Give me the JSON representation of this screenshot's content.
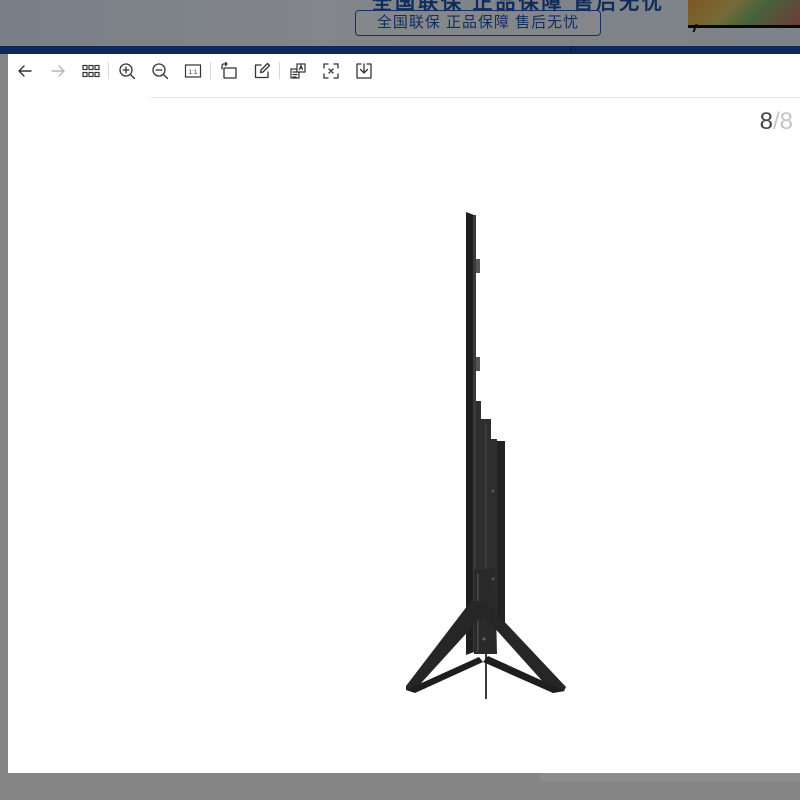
{
  "background": {
    "banner_top_text": "全国联保 正品保障 售后无忧",
    "guarantee_badge": "全国联保   正品保障   售后无忧"
  },
  "viewer": {
    "toolbar": {
      "items": [
        {
          "name": "prev",
          "label": "Previous",
          "icon": "arrow-left-icon"
        },
        {
          "name": "next",
          "label": "Next",
          "icon": "arrow-right-icon"
        },
        {
          "name": "thumbnails",
          "label": "Thumbnails",
          "icon": "grid-icon"
        },
        {
          "name": "zoom-in",
          "label": "Zoom in",
          "icon": "zoom-in-icon"
        },
        {
          "name": "zoom-out",
          "label": "Zoom out",
          "icon": "zoom-out-icon"
        },
        {
          "name": "actual-size",
          "label": "1:1",
          "icon": "actual-size-icon"
        },
        {
          "name": "rotate",
          "label": "Rotate",
          "icon": "rotate-icon"
        },
        {
          "name": "edit",
          "label": "Edit",
          "icon": "edit-icon"
        },
        {
          "name": "ocr",
          "label": "Extract text",
          "icon": "ocr-icon"
        },
        {
          "name": "fit",
          "label": "Fit to window",
          "icon": "fit-icon"
        },
        {
          "name": "download",
          "label": "Download",
          "icon": "download-icon"
        }
      ],
      "actual_size_glyph": "1:1"
    },
    "counter": {
      "current": "8",
      "separator": "/",
      "total": "8"
    },
    "image": {
      "subject": "tv-side-view-icon",
      "colors": {
        "body": "#2b2b2b",
        "stand": "#262626",
        "edge": "#4a4a4a"
      }
    }
  }
}
